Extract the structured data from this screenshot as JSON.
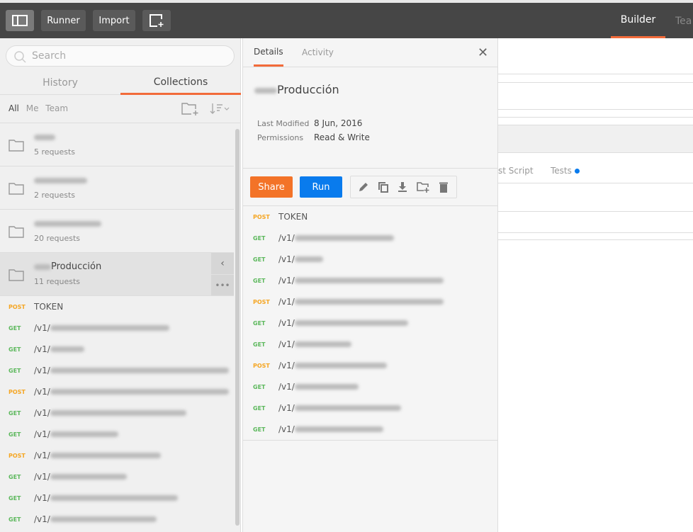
{
  "topbar": {
    "runner": "Runner",
    "import": "Import",
    "builder": "Builder",
    "team": "Tea"
  },
  "sidebar": {
    "search_placeholder": "Search",
    "tabs": [
      "History",
      "Collections"
    ],
    "filters": [
      "All",
      "Me",
      "Team"
    ],
    "collections": [
      {
        "name": "",
        "count": "5 requests"
      },
      {
        "name": "",
        "count": "2 requests"
      },
      {
        "name": "",
        "count": "20 requests"
      },
      {
        "name": "Producción",
        "count": "11 requests"
      }
    ],
    "requests": [
      {
        "method": "POST",
        "path": "TOKEN"
      },
      {
        "method": "GET",
        "path": "/v1/"
      },
      {
        "method": "GET",
        "path": "/v1/"
      },
      {
        "method": "GET",
        "path": "/v1/"
      },
      {
        "method": "POST",
        "path": "/v1/"
      },
      {
        "method": "GET",
        "path": "/v1/"
      },
      {
        "method": "GET",
        "path": "/v1/"
      },
      {
        "method": "POST",
        "path": "/v1/"
      },
      {
        "method": "GET",
        "path": "/v1/"
      },
      {
        "method": "GET",
        "path": "/v1/"
      },
      {
        "method": "GET",
        "path": "/v1/"
      }
    ]
  },
  "details": {
    "tabs": [
      "Details",
      "Activity"
    ],
    "title": "Producción",
    "last_modified_label": "Last Modified",
    "last_modified": "8 Jun, 2016",
    "permissions_label": "Permissions",
    "permissions": "Read & Write",
    "share": "Share",
    "run": "Run",
    "requests": [
      {
        "method": "POST",
        "path": "TOKEN"
      },
      {
        "method": "GET",
        "path": "/v1/"
      },
      {
        "method": "GET",
        "path": "/v1/"
      },
      {
        "method": "GET",
        "path": "/v1/"
      },
      {
        "method": "POST",
        "path": "/v1/"
      },
      {
        "method": "GET",
        "path": "/v1/"
      },
      {
        "method": "GET",
        "path": "/v1/"
      },
      {
        "method": "POST",
        "path": "/v1/"
      },
      {
        "method": "GET",
        "path": "/v1/"
      },
      {
        "method": "GET",
        "path": "/v1/"
      },
      {
        "method": "GET",
        "path": "/v1/"
      }
    ]
  },
  "builder": {
    "pre_script": "st Script",
    "tests": "Tests"
  },
  "colors": {
    "accent": "#f26b3a",
    "run": "#097bed",
    "get": "#5cb85c",
    "post": "#f5a623"
  }
}
